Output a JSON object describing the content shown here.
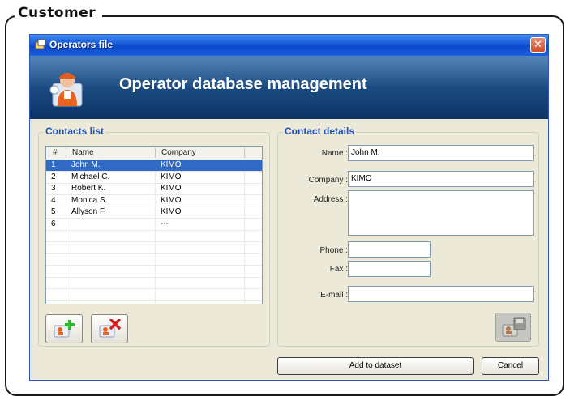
{
  "frame": {
    "title": "Customer"
  },
  "window": {
    "title": "Operators file",
    "close_glyph": "✕"
  },
  "banner": {
    "heading": "Operator database management",
    "icon": "operator-icon"
  },
  "contacts": {
    "group_label": "Contacts list",
    "columns": [
      "#",
      "Name",
      "Company"
    ],
    "rows": [
      {
        "num": "1",
        "name": "John M.",
        "company": "KIMO",
        "selected": true
      },
      {
        "num": "2",
        "name": "Michael C.",
        "company": "KIMO"
      },
      {
        "num": "3",
        "name": "Robert K.",
        "company": "KIMO"
      },
      {
        "num": "4",
        "name": "Monica S.",
        "company": "KIMO"
      },
      {
        "num": "5",
        "name": "Allyson F.",
        "company": "KIMO"
      },
      {
        "num": "6",
        "name": "",
        "company": "---"
      }
    ],
    "add_icon": "add-contact-icon",
    "delete_icon": "delete-contact-icon"
  },
  "details": {
    "group_label": "Contact details",
    "name_label": "Name :",
    "name_value": "John M.",
    "company_label": "Company :",
    "company_value": "KIMO",
    "address_label": "Address :",
    "address_value": "",
    "phone_label": "Phone :",
    "phone_value": "",
    "fax_label": "Fax :",
    "fax_value": "",
    "email_label": "E-mail :",
    "email_value": "",
    "save_icon": "save-contact-icon"
  },
  "buttons": {
    "add_to_dataset": "Add to dataset",
    "cancel": "Cancel"
  },
  "colors": {
    "selection": "#316ac5",
    "group_label": "#1e50c0",
    "banner": "#1d4f86"
  }
}
